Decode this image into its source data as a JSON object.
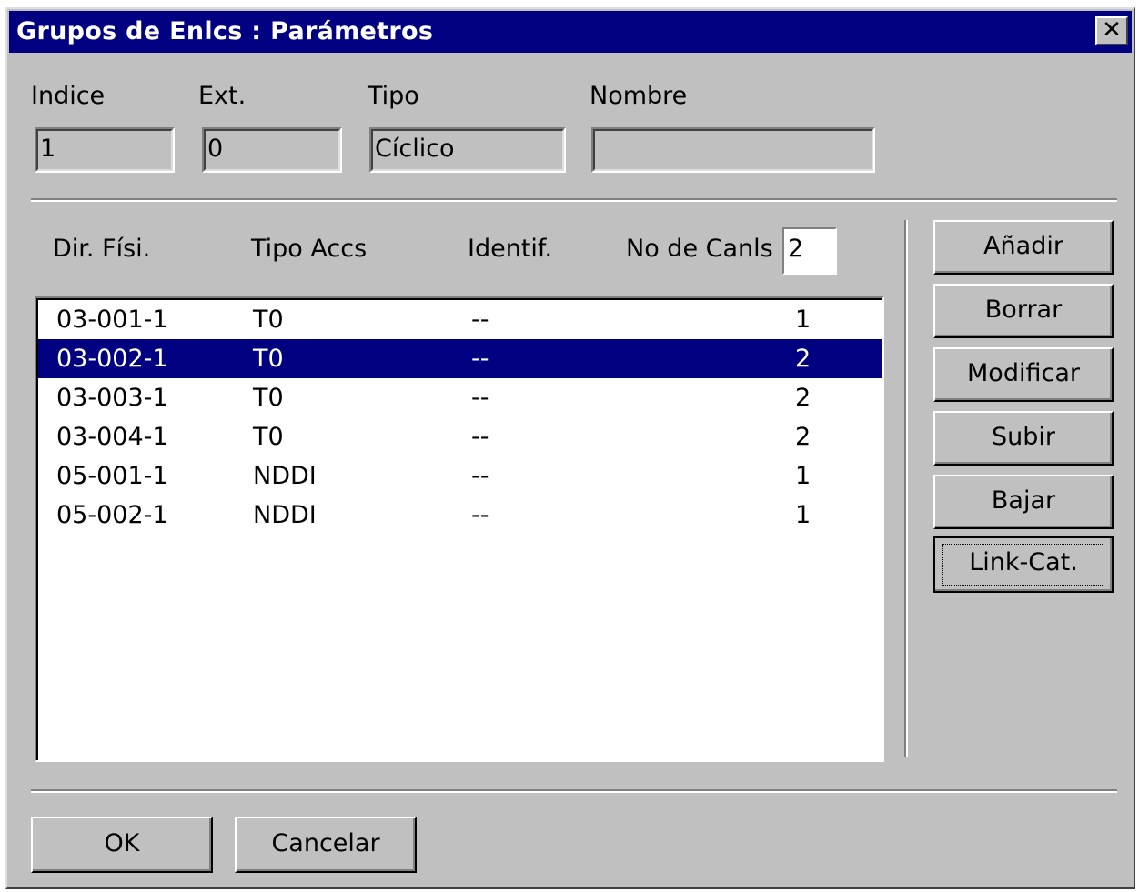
{
  "window": {
    "title": "Grupos de Enlcs : Parámetros",
    "close_glyph": "✕"
  },
  "fields": {
    "indice": {
      "label": "Indice",
      "value": "1"
    },
    "ext": {
      "label": "Ext.",
      "value": "0"
    },
    "tipo": {
      "label": "Tipo",
      "value": "Cíclico"
    },
    "nombre": {
      "label": "Nombre",
      "value": ""
    }
  },
  "list": {
    "headers": {
      "dir": "Dir. Físi.",
      "tipo": "Tipo Accs",
      "ident": "Identif.",
      "canales": "No de Canls"
    },
    "canales_value": "2",
    "selected_index": 1,
    "rows": [
      {
        "dir": "03-001-1",
        "tipo": "T0",
        "ident": "--",
        "canales": "1"
      },
      {
        "dir": "03-002-1",
        "tipo": "T0",
        "ident": "--",
        "canales": "2"
      },
      {
        "dir": "03-003-1",
        "tipo": "T0",
        "ident": "--",
        "canales": "2"
      },
      {
        "dir": "03-004-1",
        "tipo": "T0",
        "ident": "--",
        "canales": "2"
      },
      {
        "dir": "05-001-1",
        "tipo": "NDDI",
        "ident": "--",
        "canales": "1"
      },
      {
        "dir": "05-002-1",
        "tipo": "NDDI",
        "ident": "--",
        "canales": "1"
      }
    ]
  },
  "side_buttons": {
    "anadir": "Añadir",
    "borrar": "Borrar",
    "modificar": "Modificar",
    "subir": "Subir",
    "bajar": "Bajar",
    "link_cat": "Link-Cat."
  },
  "footer": {
    "ok": "OK",
    "cancel": "Cancelar"
  },
  "colors": {
    "titlebar": "#000080",
    "face": "#c0c0c0",
    "selection": "#000080"
  }
}
